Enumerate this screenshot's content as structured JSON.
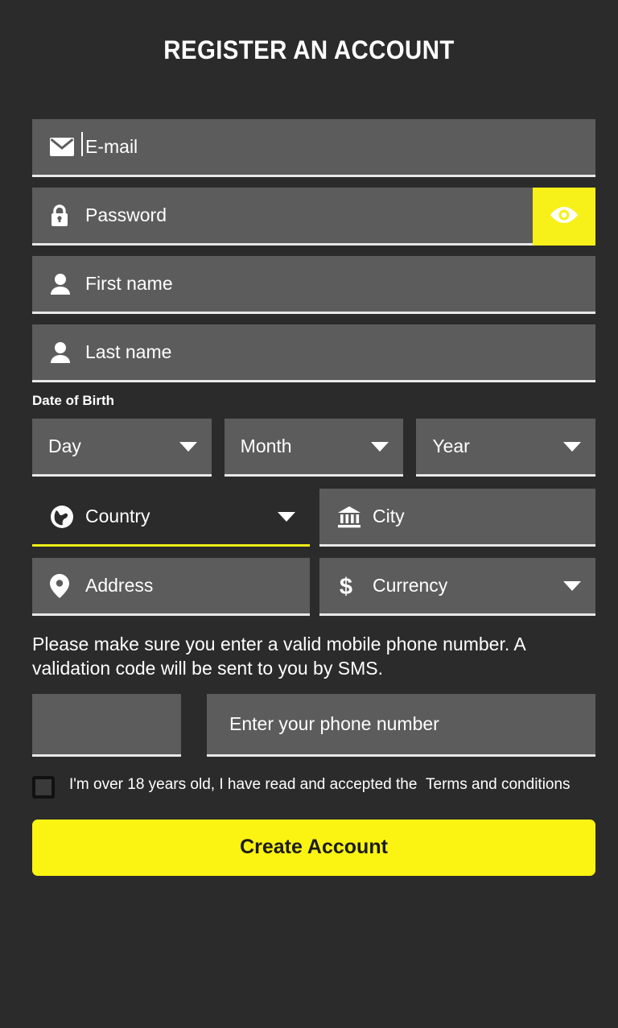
{
  "page": {
    "title": "REGISTER AN ACCOUNT",
    "background_color": "#2b2b2b",
    "accent_color": "#fbf312",
    "field_color": "#5c5c5c"
  },
  "fields": {
    "email": {
      "placeholder": "E-mail",
      "icon": "envelope-icon",
      "value": ""
    },
    "password": {
      "placeholder": "Password",
      "icon": "lock-icon",
      "value": "",
      "reveal_icon": "eye-icon"
    },
    "first_name": {
      "placeholder": "First name",
      "icon": "person-icon",
      "value": ""
    },
    "last_name": {
      "placeholder": "Last name",
      "icon": "person-icon",
      "value": ""
    }
  },
  "date_of_birth": {
    "label": "Date of Birth",
    "day": {
      "value": "Day"
    },
    "month": {
      "value": "Month"
    },
    "year": {
      "value": "Year"
    }
  },
  "location": {
    "country": {
      "value": "Country",
      "icon": "globe-icon",
      "focused": true,
      "underline_color": "#eded18"
    },
    "city": {
      "placeholder": "City",
      "icon": "bank-icon",
      "value": ""
    },
    "address": {
      "placeholder": "Address",
      "icon": "map-pin-icon",
      "value": ""
    },
    "currency": {
      "value": "Currency",
      "icon": "dollar-icon"
    }
  },
  "phone": {
    "notice": "Please make sure you enter a valid mobile phone number. A validation code will be sent to you by SMS.",
    "country_code": {
      "value": ""
    },
    "number": {
      "placeholder": "Enter your phone number",
      "value": ""
    }
  },
  "terms": {
    "checked": false,
    "text": "I'm over 18 years old, I have read and accepted the",
    "link_text": "Terms and conditions"
  },
  "submit": {
    "label": "Create Account"
  }
}
